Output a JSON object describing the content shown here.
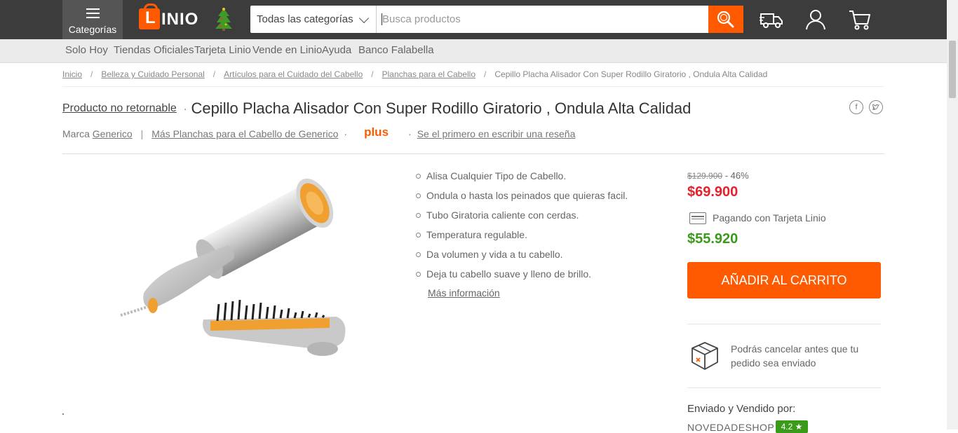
{
  "header": {
    "categories_label": "Categorías",
    "logo_text": "LINIO",
    "search_category": "Todas las categorías",
    "search_placeholder": "Busca productos",
    "colors": {
      "bar": "#3c3c3c",
      "accent": "#ff5a00"
    },
    "icons": [
      "menu-icon",
      "truck-icon",
      "user-icon",
      "cart-icon",
      "search-icon"
    ]
  },
  "subnav": [
    "Solo Hoy",
    "Tiendas Oficiales",
    "Tarjeta Linio",
    "Vende en Linio",
    "Ayuda",
    "Banco Falabella"
  ],
  "breadcrumb": [
    "Inicio",
    "Belleza y Cuidado Personal",
    "Artículos para el Cuidado del Cabello",
    "Planchas para el Cabello",
    "Cepillo Placha Alisador Con Super Rodillo Giratorio , Ondula Alta Calidad"
  ],
  "product": {
    "non_returnable": "Producto no retornable",
    "title": "Cepillo Placha Alisador Con Super Rodillo Giratorio , Ondula Alta Calidad",
    "brand_prefix": "Marca",
    "brand": "Generico",
    "more_link": "Más Planchas para el Cabello de Generico",
    "plus_label": "plus",
    "review_link": "Se el primero en escribir una reseña",
    "features": [
      "Alisa Cualquier Tipo de Cabello.",
      "Ondula o hasta los peinados que quieras facil.",
      "Tubo Giratoria caliente con cerdas.",
      "Temperatura regulable.",
      "Da volumen y vida a tu cabello.",
      "Deja tu cabello suave y lleno de brillo."
    ],
    "more_info": "Más información"
  },
  "pricing": {
    "old_price": "$129.900",
    "discount": "- 46%",
    "price": "$69.900",
    "card_label": "Pagando con Tarjeta Linio",
    "card_price": "$55.920",
    "add_to_cart": "AÑADIR AL CARRITO",
    "cancel_note": "Podrás cancelar antes que tu pedido sea enviado",
    "sold_by_label": "Enviado y Vendido por:",
    "seller": "NOVEDADESHOP",
    "rating": "4.2 ★",
    "colors": {
      "price": "#e4212c",
      "card_price": "#3a9a1a"
    }
  }
}
